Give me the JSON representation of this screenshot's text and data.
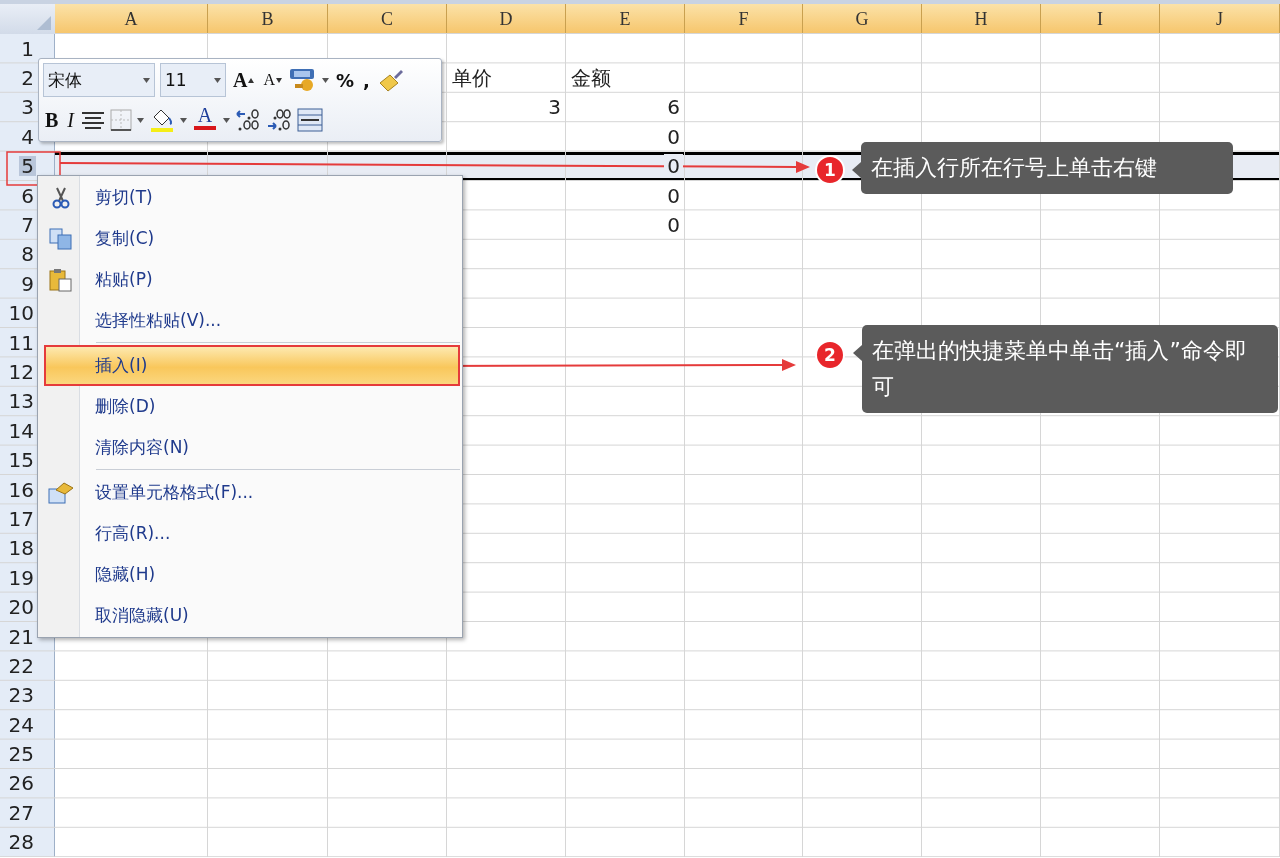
{
  "columns": [
    "A",
    "B",
    "C",
    "D",
    "E",
    "F",
    "G",
    "H",
    "I",
    "J"
  ],
  "rows": [
    {
      "label": "1",
      "selected": false,
      "cells": {}
    },
    {
      "label": "2",
      "selected": false,
      "cells": {
        "d": {
          "text": "单价",
          "numeric": false
        },
        "e": {
          "text": "金额",
          "numeric": false
        }
      }
    },
    {
      "label": "3",
      "selected": false,
      "cells": {
        "d": {
          "text": "3",
          "numeric": true
        },
        "e": {
          "text": "6",
          "numeric": true
        }
      }
    },
    {
      "label": "4",
      "selected": false,
      "cells": {
        "e": {
          "text": "0",
          "numeric": true
        }
      }
    },
    {
      "label": "5",
      "selected": true,
      "cells": {
        "e": {
          "text": "0",
          "numeric": true
        }
      }
    },
    {
      "label": "6",
      "selected": false,
      "cells": {
        "e": {
          "text": "0",
          "numeric": true
        }
      }
    },
    {
      "label": "7",
      "selected": false,
      "cells": {
        "e": {
          "text": "0",
          "numeric": true
        }
      }
    },
    {
      "label": "8",
      "selected": false,
      "cells": {}
    },
    {
      "label": "9",
      "selected": false,
      "cells": {}
    },
    {
      "label": "10",
      "selected": false,
      "cells": {}
    },
    {
      "label": "11",
      "selected": false,
      "cells": {}
    },
    {
      "label": "12",
      "selected": false,
      "cells": {}
    },
    {
      "label": "13",
      "selected": false,
      "cells": {}
    },
    {
      "label": "14",
      "selected": false,
      "cells": {}
    },
    {
      "label": "15",
      "selected": false,
      "cells": {}
    },
    {
      "label": "16",
      "selected": false,
      "cells": {}
    },
    {
      "label": "17",
      "selected": false,
      "cells": {}
    },
    {
      "label": "18",
      "selected": false,
      "cells": {}
    },
    {
      "label": "19",
      "selected": false,
      "cells": {}
    },
    {
      "label": "20",
      "selected": false,
      "cells": {}
    },
    {
      "label": "21",
      "selected": false,
      "cells": {}
    },
    {
      "label": "22",
      "selected": false,
      "cells": {}
    },
    {
      "label": "23",
      "selected": false,
      "cells": {}
    },
    {
      "label": "24",
      "selected": false,
      "cells": {}
    },
    {
      "label": "25",
      "selected": false,
      "cells": {}
    },
    {
      "label": "26",
      "selected": false,
      "cells": {}
    },
    {
      "label": "27",
      "selected": false,
      "cells": {}
    },
    {
      "label": "28",
      "selected": false,
      "cells": {}
    }
  ],
  "mini_toolbar": {
    "font": "宋体",
    "size": "11",
    "row1": [
      {
        "kind": "grow-font",
        "text": "A"
      },
      {
        "kind": "shrink-font",
        "text": "A"
      },
      {
        "kind": "accounting"
      },
      {
        "kind": "caret"
      },
      {
        "kind": "char",
        "text": "%"
      },
      {
        "kind": "char",
        "text": ","
      },
      {
        "kind": "painter"
      }
    ],
    "row2": [
      {
        "kind": "bold",
        "text": "B"
      },
      {
        "kind": "italic",
        "text": "I"
      },
      {
        "kind": "align"
      },
      {
        "kind": "border"
      },
      {
        "kind": "caret"
      },
      {
        "kind": "fill"
      },
      {
        "kind": "caret"
      },
      {
        "kind": "font-color",
        "text": "A"
      },
      {
        "kind": "caret"
      },
      {
        "kind": "inc-decimal"
      },
      {
        "kind": "dec-decimal"
      },
      {
        "kind": "merge"
      }
    ]
  },
  "context_menu": [
    {
      "label": "剪切(T)",
      "kind": "cut",
      "selected": false,
      "separator_before": false
    },
    {
      "label": "复制(C)",
      "kind": "copy",
      "selected": false,
      "separator_before": false
    },
    {
      "label": "粘贴(P)",
      "kind": "paste",
      "selected": false,
      "separator_before": false
    },
    {
      "label": "选择性粘贴(V)...",
      "kind": "plain",
      "selected": false,
      "separator_before": false
    },
    {
      "label": "插入(I)",
      "kind": "plain",
      "selected": true,
      "separator_before": true
    },
    {
      "label": "删除(D)",
      "kind": "plain",
      "selected": false,
      "separator_before": false
    },
    {
      "label": "清除内容(N)",
      "kind": "plain",
      "selected": false,
      "separator_before": false
    },
    {
      "label": "设置单元格格式(F)...",
      "kind": "format",
      "selected": false,
      "separator_before": true
    },
    {
      "label": "行高(R)...",
      "kind": "plain",
      "selected": false,
      "separator_before": false
    },
    {
      "label": "隐藏(H)",
      "kind": "plain",
      "selected": false,
      "separator_before": false
    },
    {
      "label": "取消隐藏(U)",
      "kind": "plain",
      "selected": false,
      "separator_before": false
    }
  ],
  "callouts": [
    {
      "number": "1",
      "text": "在插入行所在行号上单击右键"
    },
    {
      "number": "2",
      "text": "在弹出的快捷菜单中单击“插入”命令即可"
    }
  ]
}
